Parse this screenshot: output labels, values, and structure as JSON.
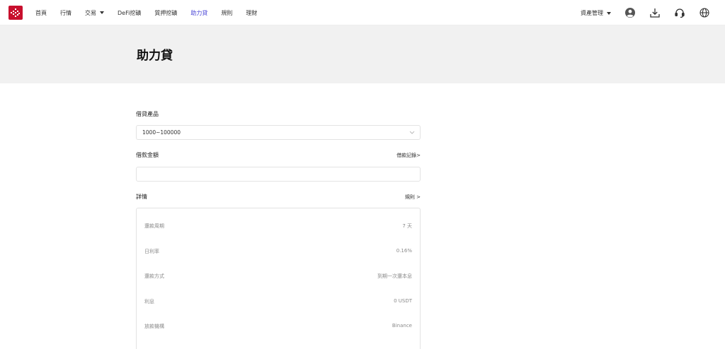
{
  "nav": {
    "items": [
      {
        "label": "首頁"
      },
      {
        "label": "行情"
      },
      {
        "label": "交易",
        "has_dropdown": true
      },
      {
        "label": "DeFi挖礦"
      },
      {
        "label": "質押挖礦"
      },
      {
        "label": "助力貸",
        "active": true
      },
      {
        "label": "規則"
      },
      {
        "label": "理財"
      }
    ],
    "asset_mgmt_label": "資產管理",
    "active_color": "#4a46d6"
  },
  "brand": {
    "logo_color": "#c8102e"
  },
  "icons": {
    "logo": "logo-icon",
    "user": "user-avatar-icon",
    "download": "download-icon",
    "support": "headset-icon",
    "language": "globe-icon",
    "select_chevron": "chevron-down-icon"
  },
  "page": {
    "title": "助力貸"
  },
  "form": {
    "product_label": "借貸產品",
    "product_value": "1000~100000",
    "amount_label": "借款金額",
    "amount_value": "",
    "records_link": "借款記錄>",
    "details_label": "詳情",
    "rules_link": "規則 >"
  },
  "details": [
    {
      "key": "還款周期",
      "value": "7 天"
    },
    {
      "key": "日利率",
      "value": "0.16%"
    },
    {
      "key": "還款方式",
      "value": "到期一次還本息"
    },
    {
      "key": "利息",
      "value": "0 USDT"
    },
    {
      "key": "放款機構",
      "value": "Binance"
    }
  ]
}
